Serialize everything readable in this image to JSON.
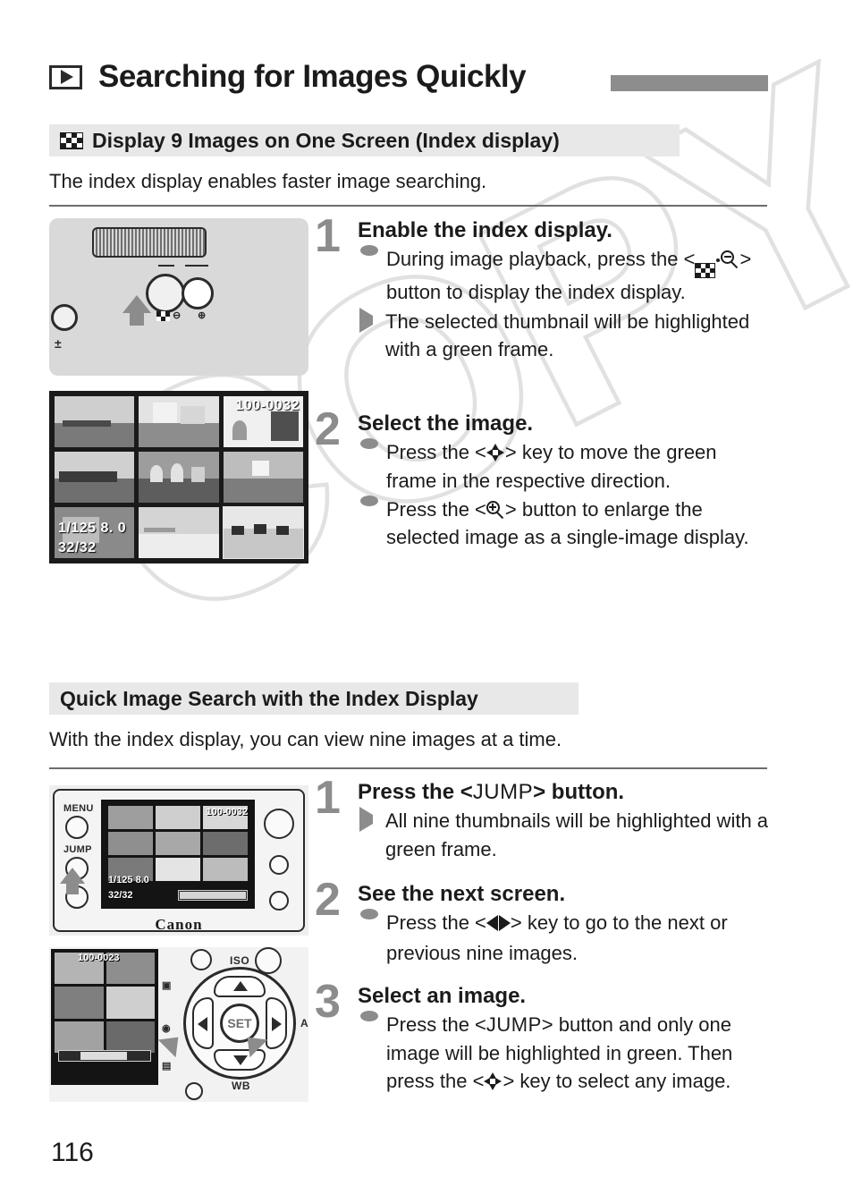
{
  "header": {
    "playback_icon": "playback-icon",
    "title": "Searching for Images Quickly",
    "accent_bar_color": "#8d8d8d"
  },
  "page_number": "116",
  "watermark": {
    "text": "COPY"
  },
  "sections": [
    {
      "icon": "index-display-icon",
      "heading": "Display 9 Images on One Screen (Index display)",
      "lead": "The index display enables faster image searching.",
      "steps": [
        {
          "number": "1",
          "title": "Enable the index display.",
          "bullets": [
            {
              "marker": "dot",
              "parts": [
                "During image playback, press the <",
                "icon:index-zoom-out",
                "> button to display the index display."
              ]
            },
            {
              "marker": "arrow",
              "parts": [
                "The selected thumbnail will be highlighted with a green frame."
              ]
            }
          ]
        },
        {
          "number": "2",
          "title": "Select the image.",
          "bullets": [
            {
              "marker": "dot",
              "parts": [
                "Press the <",
                "icon:cross-keys",
                "> key to move the green frame in the respective direction."
              ]
            },
            {
              "marker": "dot",
              "parts": [
                "Press the <",
                "icon:zoom-in",
                "> button to enlarge the selected image as a single-image display."
              ]
            }
          ]
        }
      ]
    },
    {
      "icon": null,
      "heading": "Quick Image Search with the Index Display",
      "lead": "With the index display, you can view nine images at a time.",
      "steps": [
        {
          "number": "1",
          "title_parts": [
            "Press the <",
            "JUMP",
            "> button."
          ],
          "title": "Press the <JUMP> button.",
          "bullets": [
            {
              "marker": "arrow",
              "parts": [
                "All nine thumbnails will be highlighted with a green frame."
              ]
            }
          ]
        },
        {
          "number": "2",
          "title": "See the next screen.",
          "bullets": [
            {
              "marker": "dot",
              "parts": [
                "Press the <",
                "icon:left-right-keys",
                "> key to go to the next or previous nine images."
              ]
            }
          ]
        },
        {
          "number": "3",
          "title": "Select an image.",
          "bullets": [
            {
              "marker": "dot",
              "parts": [
                "Press the <",
                "JUMP",
                "> button and only one image will be highlighted in green. Then press the <",
                "icon:cross-keys",
                "> key to select any image."
              ]
            }
          ]
        }
      ]
    }
  ],
  "figures": {
    "camera_top": {
      "name": "camera-top-controls-illustration",
      "labels": [
        "index-zoom-out-mark",
        "zoom-in-mark",
        "exposure-compensation-mark"
      ]
    },
    "index_screen": {
      "name": "index-display-screen",
      "file_number": "100-0032",
      "exposure": "1/125   8. 0",
      "image_count": "32/32",
      "thumbnails": 9,
      "selected_index": 8
    },
    "camera_back": {
      "name": "camera-back-lcd-illustration",
      "buttons": [
        "MENU",
        "JUMP"
      ],
      "brand": "Canon",
      "lcd": {
        "exposure": "1/125  8.0",
        "image_count": "32/32",
        "file_number": "100-0032"
      }
    },
    "multi_controller": {
      "name": "multi-controller-illustration",
      "center_label": "SET",
      "key_labels": {
        "up": "ISO",
        "down": "WB",
        "right": "AF"
      },
      "screen_file_number": "100-0023"
    }
  },
  "glyphs": {
    "jump": "JUMP"
  }
}
